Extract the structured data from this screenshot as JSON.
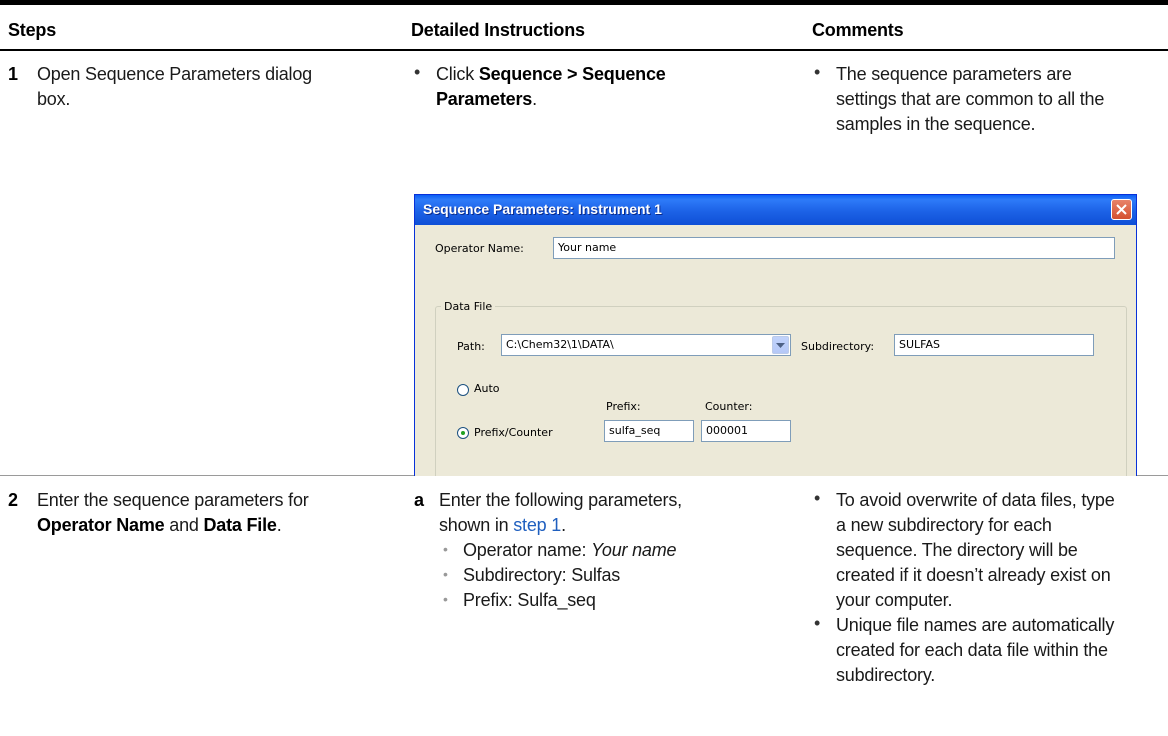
{
  "headers": {
    "steps": "Steps",
    "detailed": "Detailed Instructions",
    "comments": "Comments"
  },
  "row1": {
    "num": "1",
    "step_line1": "Open Sequence Parameters dialog",
    "step_line2": "box.",
    "instr_prefix": "Click ",
    "instr_bold1": "Sequence > Sequence",
    "instr_bold2": "Parameters",
    "instr_suffix": ".",
    "comment_line1": "The sequence parameters are",
    "comment_line2": "settings that are common to all the",
    "comment_line3": "samples in the sequence."
  },
  "dialog": {
    "title": "Sequence Parameters: Instrument 1",
    "operator_label": "Operator Name:",
    "operator_value": "Your name",
    "group_label": "Data File",
    "path_label": "Path:",
    "path_value": "C:\\Chem32\\1\\DATA\\",
    "subdir_label": "Subdirectory:",
    "subdir_value": "SULFAS",
    "auto_label": "Auto",
    "prefix_counter_label": "Prefix/Counter",
    "prefix_label": "Prefix:",
    "prefix_value": "sulfa_seq",
    "counter_label": "Counter:",
    "counter_value": "000001"
  },
  "row2": {
    "num": "2",
    "step_line1": "Enter the sequence parameters for",
    "step_bold1": "Operator Name",
    "step_and": " and ",
    "step_bold2": "Data File",
    "step_period": ".",
    "sub_letter": "a",
    "instr_line1": "Enter the following parameters,",
    "instr_line2_prefix": "shown in ",
    "instr_link": "step 1",
    "instr_line2_suffix": ".",
    "item1_prefix": "Operator name: ",
    "item1_value": "Your name",
    "item2": "Subdirectory: Sulfas",
    "item3": "Prefix: Sulfa_seq",
    "comment1_line1": "To avoid overwrite of data files, type",
    "comment1_line2": "a new subdirectory for each",
    "comment1_line3": "sequence. The directory will be",
    "comment1_line4": "created if it doesn’t already exist on",
    "comment1_line5": "your computer.",
    "comment2_line1": "Unique file names are automatically",
    "comment2_line2": "created for each data file within the",
    "comment2_line3": "subdirectory."
  }
}
